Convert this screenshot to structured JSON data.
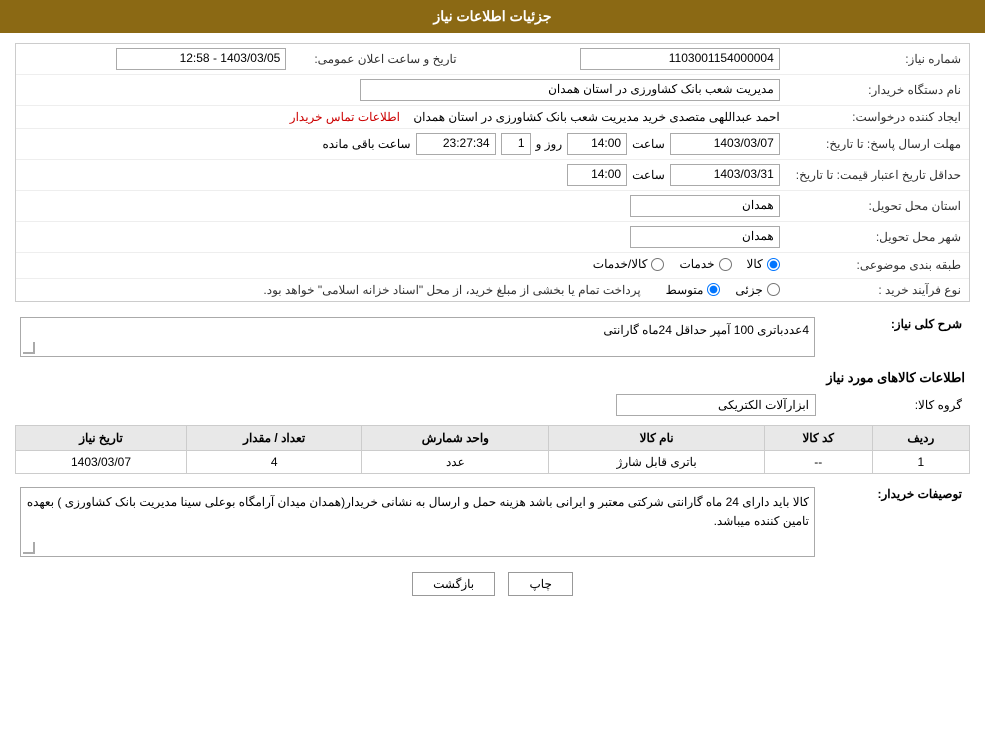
{
  "header": {
    "title": "جزئیات اطلاعات نیاز"
  },
  "fields": {
    "shomareNiaz_label": "شماره نیاز:",
    "shomareNiaz_value": "1103001154000004",
    "namDastgah_label": "نام دستگاه خریدار:",
    "namDastgah_value": "مدیریت شعب بانک کشاورزی در استان همدان",
    "tarikh_label": "تاریخ و ساعت اعلان عمومی:",
    "tarikh_value": "1403/03/05 - 12:58",
    "ijadKonande_label": "ایجاد کننده درخواست:",
    "ijadKonande_value": "احمد عبداللهی متصدی خرید مدیریت شعب بانک کشاورزی در استان همدان",
    "contactLink": "اطلاعات تماس خریدار",
    "mohlat_label": "مهلت ارسال پاسخ: تا تاریخ:",
    "mohlat_date": "1403/03/07",
    "mohlat_time": "14:00",
    "mohlat_days": "1",
    "mohlat_clock": "23:27:34",
    "mohlat_remaining": "ساعت باقی مانده",
    "hadaghol_label": "حداقل تاریخ اعتبار قیمت: تا تاریخ:",
    "hadaghol_date": "1403/03/31",
    "hadaghol_time": "14:00",
    "ostan_label": "استان محل تحویل:",
    "ostan_value": "همدان",
    "shahr_label": "شهر محل تحویل:",
    "shahr_value": "همدان",
    "tabaqe_label": "طبقه بندی موضوعی:",
    "radio_kala": "کالا",
    "radio_khadamat": "خدمات",
    "radio_kala_khadamat": "کالا/خدمات",
    "radio_selected": "kala",
    "noFaraind_label": "نوع فرآیند خرید :",
    "radio_jazee": "جزئی",
    "radio_motavaset": "متوسط",
    "radio_selected_faraind": "motavaset",
    "noFaraind_desc": "پرداخت تمام یا بخشی از مبلغ خرید، از محل \"اسناد خزانه اسلامی\" خواهد بود.",
    "shrh_niaz_label": "شرح کلی نیاز:",
    "shrh_niaz_value": "4عددباتری 100 آمپر حداقل 24ماه گارانتی",
    "info_kala_label": "اطلاعات کالاهای مورد نیاز",
    "group_kala_label": "گروه کالا:",
    "group_kala_value": "ابزارآلات الکتریکی",
    "table_header": {
      "radif": "ردیف",
      "kod_kala": "کد کالا",
      "nam_kala": "نام کالا",
      "vahed": "واحد شمارش",
      "tedad": "تعداد / مقدار",
      "tarikh": "تاریخ نیاز"
    },
    "table_rows": [
      {
        "radif": "1",
        "kod_kala": "--",
        "nam_kala": "باتری قابل شارژ",
        "vahed": "عدد",
        "tedad": "4",
        "tarikh": "1403/03/07"
      }
    ],
    "tossif_label": "توصیفات خریدار:",
    "tossif_value": "کالا باید دارای 24 ماه گارانتی شرکتی معتبر و ایرانی باشد هزینه حمل و ارسال به نشانی خریدار(همدان میدان آرامگاه بوعلی سینا مدیریت بانک کشاورزی ) بعهده تامین کننده میباشد.",
    "btn_chap": "چاپ",
    "btn_bazgasht": "بازگشت"
  }
}
